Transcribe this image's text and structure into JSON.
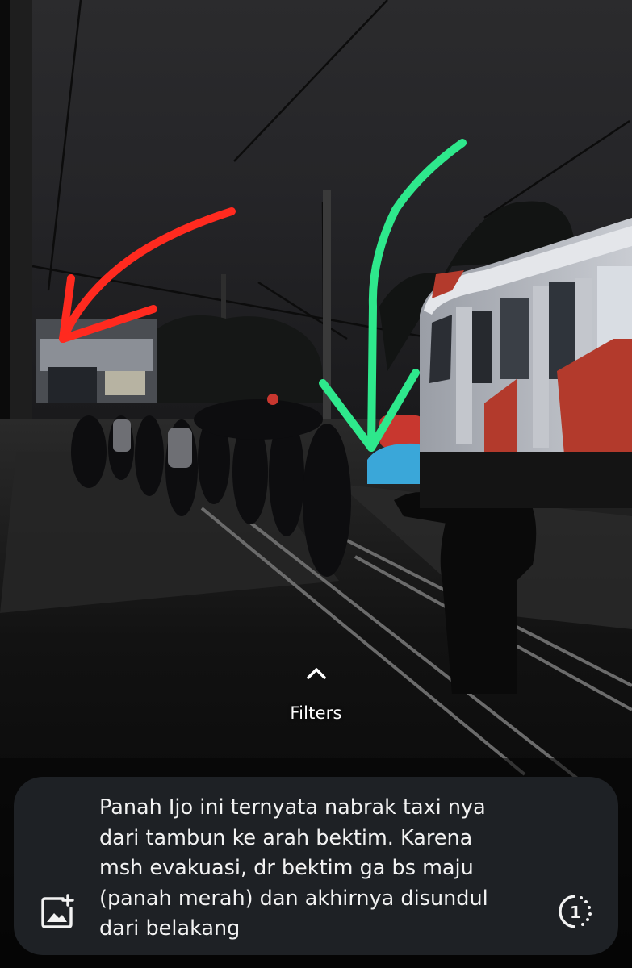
{
  "filters": {
    "label": "Filters",
    "icon": "chevron-up-icon"
  },
  "caption": {
    "text": "Panah Ijo ini ternyata nabrak taxi nya\ndari tambun ke arah bektim. Karena\nmsh evakuasi, dr bektim ga bs maju\n(panah merah) dan akhirnya disundul\ndari belakang",
    "add_photo_icon": "add-photo-icon",
    "timer_icon": "view-once-timer-icon",
    "timer_value": "1"
  },
  "colors": {
    "caption_bg": "#1e2125",
    "arrow_red": "#ff2a1f",
    "arrow_green": "#2ee88c",
    "train_red": "#b33a2c"
  }
}
